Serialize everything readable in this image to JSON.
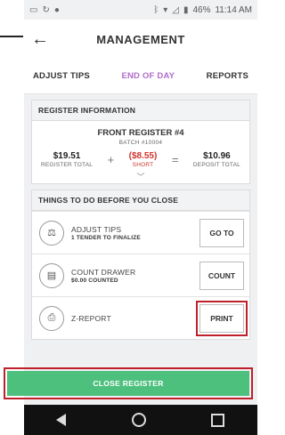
{
  "statusbar": {
    "left_icons": [
      "image-icon",
      "sync-icon",
      "location-icon"
    ],
    "right_icons": [
      "bluetooth-icon",
      "wifi-icon",
      "signal-icon",
      "battery-icon"
    ],
    "battery": "46%",
    "time": "11:14 AM"
  },
  "header": {
    "title": "MANAGEMENT"
  },
  "tabs": [
    {
      "label": "ADJUST TIPS",
      "active": false
    },
    {
      "label": "END OF DAY",
      "active": true
    },
    {
      "label": "REPORTS",
      "active": false
    }
  ],
  "register_info": {
    "heading": "REGISTER INFORMATION",
    "name": "FRONT REGISTER #4",
    "batch": "BATCH #10004",
    "register_total": {
      "value": "$19.51",
      "label": "REGISTER TOTAL"
    },
    "plus": "+",
    "short": {
      "value": "($8.55)",
      "label": "SHORT"
    },
    "equals": "=",
    "deposit_total": {
      "value": "$10.96",
      "label": "DEPOSIT TOTAL"
    }
  },
  "todo": {
    "heading": "THINGS TO DO BEFORE YOU CLOSE",
    "items": [
      {
        "icon": "scale-icon",
        "title": "ADJUST TIPS",
        "subtitle": "1 TENDER TO FINALIZE",
        "button": "GO TO"
      },
      {
        "icon": "cash-drawer-icon",
        "title": "COUNT DRAWER",
        "subtitle": "$0.00 COUNTED",
        "button": "COUNT"
      },
      {
        "icon": "printer-icon",
        "title": "Z-REPORT",
        "subtitle": "",
        "button": "PRINT"
      }
    ]
  },
  "close_register": {
    "label": "CLOSE REGISTER"
  },
  "colors": {
    "accent_tab": "#b06bc9",
    "short": "#d0342c",
    "close_button": "#4ec07e",
    "highlight": "#c0202a"
  }
}
